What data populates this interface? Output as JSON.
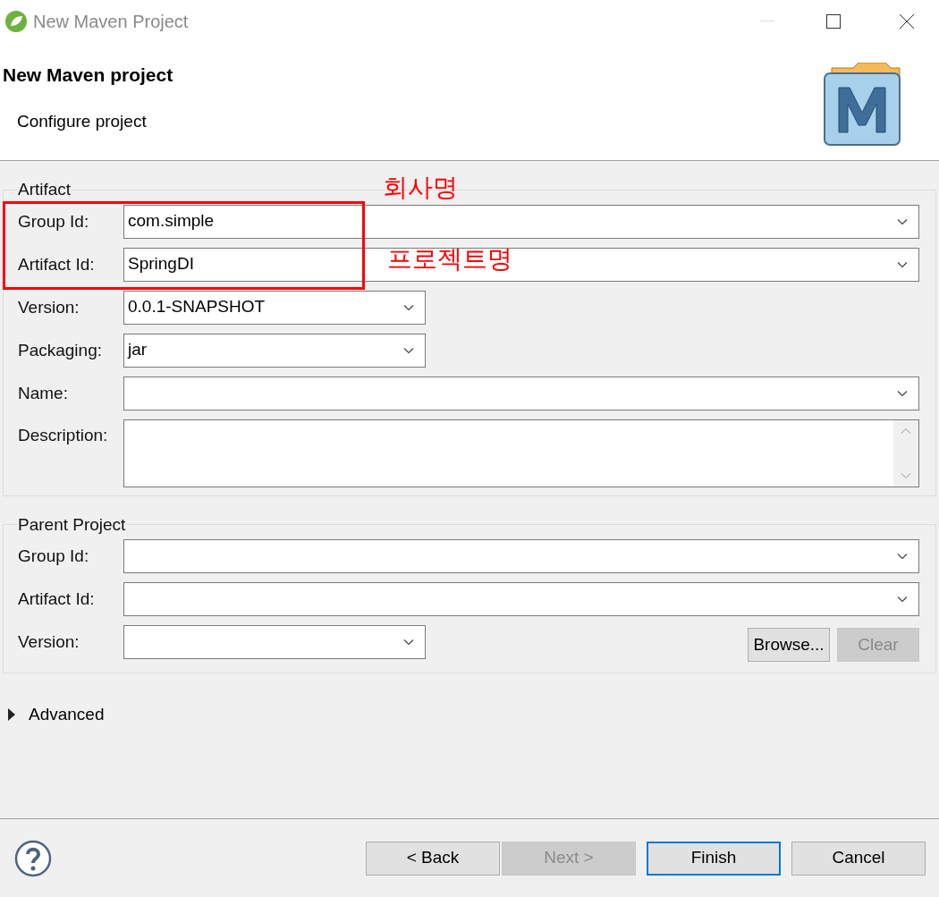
{
  "window": {
    "title": "New Maven Project"
  },
  "header": {
    "title": "New Maven project",
    "subtitle": "Configure project"
  },
  "artifact": {
    "legend": "Artifact",
    "fields": [
      {
        "label": "Group Id:",
        "value": "com.simple",
        "kind": "wide"
      },
      {
        "label": "Artifact Id:",
        "value": "SpringDI",
        "kind": "wide"
      },
      {
        "label": "Version:",
        "value": "0.0.1-SNAPSHOT",
        "kind": "narrow"
      },
      {
        "label": "Packaging:",
        "value": "jar",
        "kind": "narrow"
      },
      {
        "label": "Name:",
        "kind": "wide"
      },
      {
        "label": "Description:",
        "kind": "textarea"
      }
    ],
    "annotations": [
      "회사명",
      "프로젝트명"
    ]
  },
  "parent_project": {
    "legend": "Parent Project",
    "fields": [
      {
        "label": "Group Id:",
        "kind": "wide"
      },
      {
        "label": "Artifact Id:",
        "kind": "wide"
      },
      {
        "label": "Version:",
        "kind": "narrow"
      }
    ],
    "buttons": [
      {
        "label": "Browse...",
        "disabled": false
      },
      {
        "label": "Clear",
        "disabled": true
      }
    ]
  },
  "advanced": {
    "label": "Advanced",
    "expanded": false
  },
  "footer": {
    "buttons": [
      {
        "label": "< Back",
        "disabled": false,
        "default": false
      },
      {
        "label": "Next >",
        "disabled": true,
        "default": false
      },
      {
        "label": "Finish",
        "disabled": false,
        "default": true
      },
      {
        "label": "Cancel",
        "disabled": false,
        "default": false
      }
    ]
  }
}
